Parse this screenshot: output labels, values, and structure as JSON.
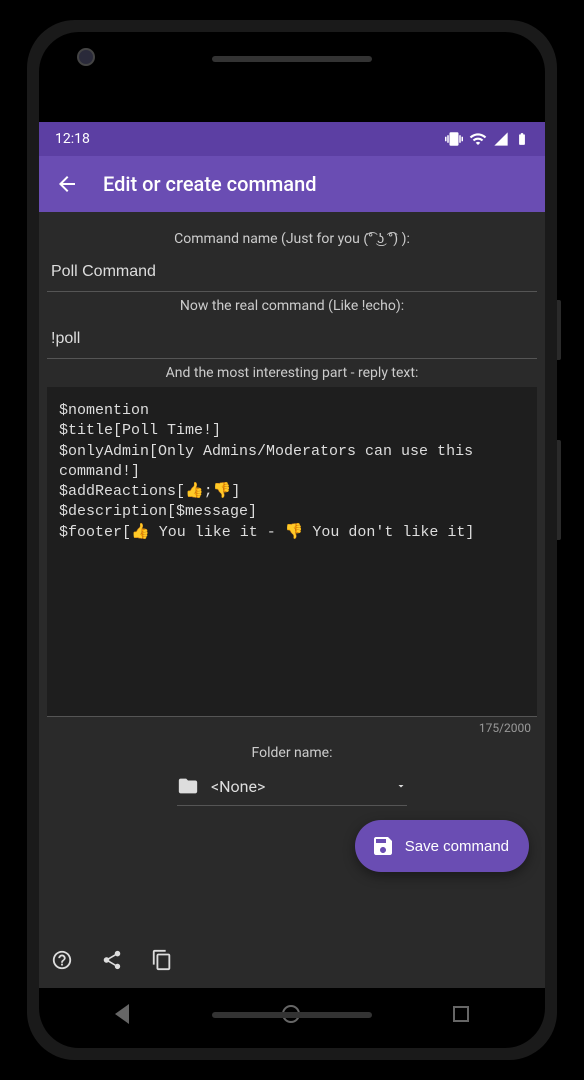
{
  "status": {
    "time": "12:18"
  },
  "appbar": {
    "title": "Edit or create command"
  },
  "labels": {
    "command_name": "Command name (Just for you (͡° ͜ʖ ͡°) ):",
    "real_command": "Now the real command (Like !echo):",
    "reply_text": "And the most interesting part - reply text:",
    "folder_name": "Folder name:"
  },
  "fields": {
    "command_name_value": "Poll Command",
    "real_command_value": "!poll",
    "reply_text_value": "$nomention\n$title[Poll Time!]\n$onlyAdmin[Only Admins/Moderators can use this command!]\n$addReactions[👍;👎]\n$description[$message]\n$footer[👍 You like it - 👎 You don't like it]",
    "char_count": "175/2000",
    "folder_value": "<None>"
  },
  "buttons": {
    "save": "Save command"
  }
}
